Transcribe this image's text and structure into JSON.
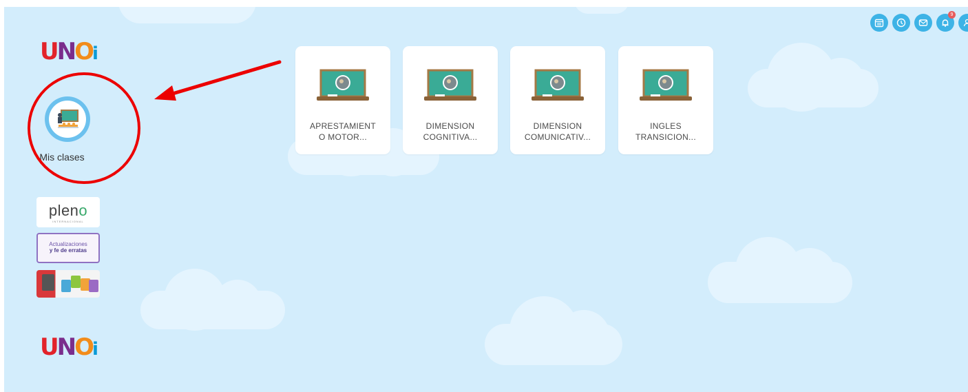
{
  "sidebar": {
    "nav_items": [
      {
        "label": "Mis clases",
        "icon": "classroom-icon"
      }
    ],
    "banners": [
      {
        "name": "pleno",
        "word": "plen",
        "word_accent": "o",
        "sub": "INTERNACIONAL"
      },
      {
        "name": "actualizaciones",
        "line1": "Actualizaciones",
        "line2": "y fe de erratas"
      },
      {
        "name": "books",
        "icon": "books-banner"
      }
    ]
  },
  "logo": {
    "l1": "U",
    "l2": "N",
    "l3": "O",
    "l4": "i"
  },
  "header_icons": [
    {
      "name": "calendar-icon"
    },
    {
      "name": "clock-icon"
    },
    {
      "name": "mail-icon"
    },
    {
      "name": "bell-icon",
      "badge": "9"
    },
    {
      "name": "user-icon"
    }
  ],
  "courses": [
    {
      "line1": "APRESTAMIENT",
      "line2": "O MOTOR..."
    },
    {
      "line1": "DIMENSION",
      "line2": "COGNITIVA..."
    },
    {
      "line1": "DIMENSION",
      "line2": "COMUNICATIV..."
    },
    {
      "line1": "INGLES",
      "line2": "TRANSICION..."
    }
  ],
  "colors": {
    "background": "#d3edfc",
    "accent": "#3db3e6",
    "annotation": "#ec0000",
    "chalkboard": "#3aab96",
    "frame": "#a57945"
  }
}
